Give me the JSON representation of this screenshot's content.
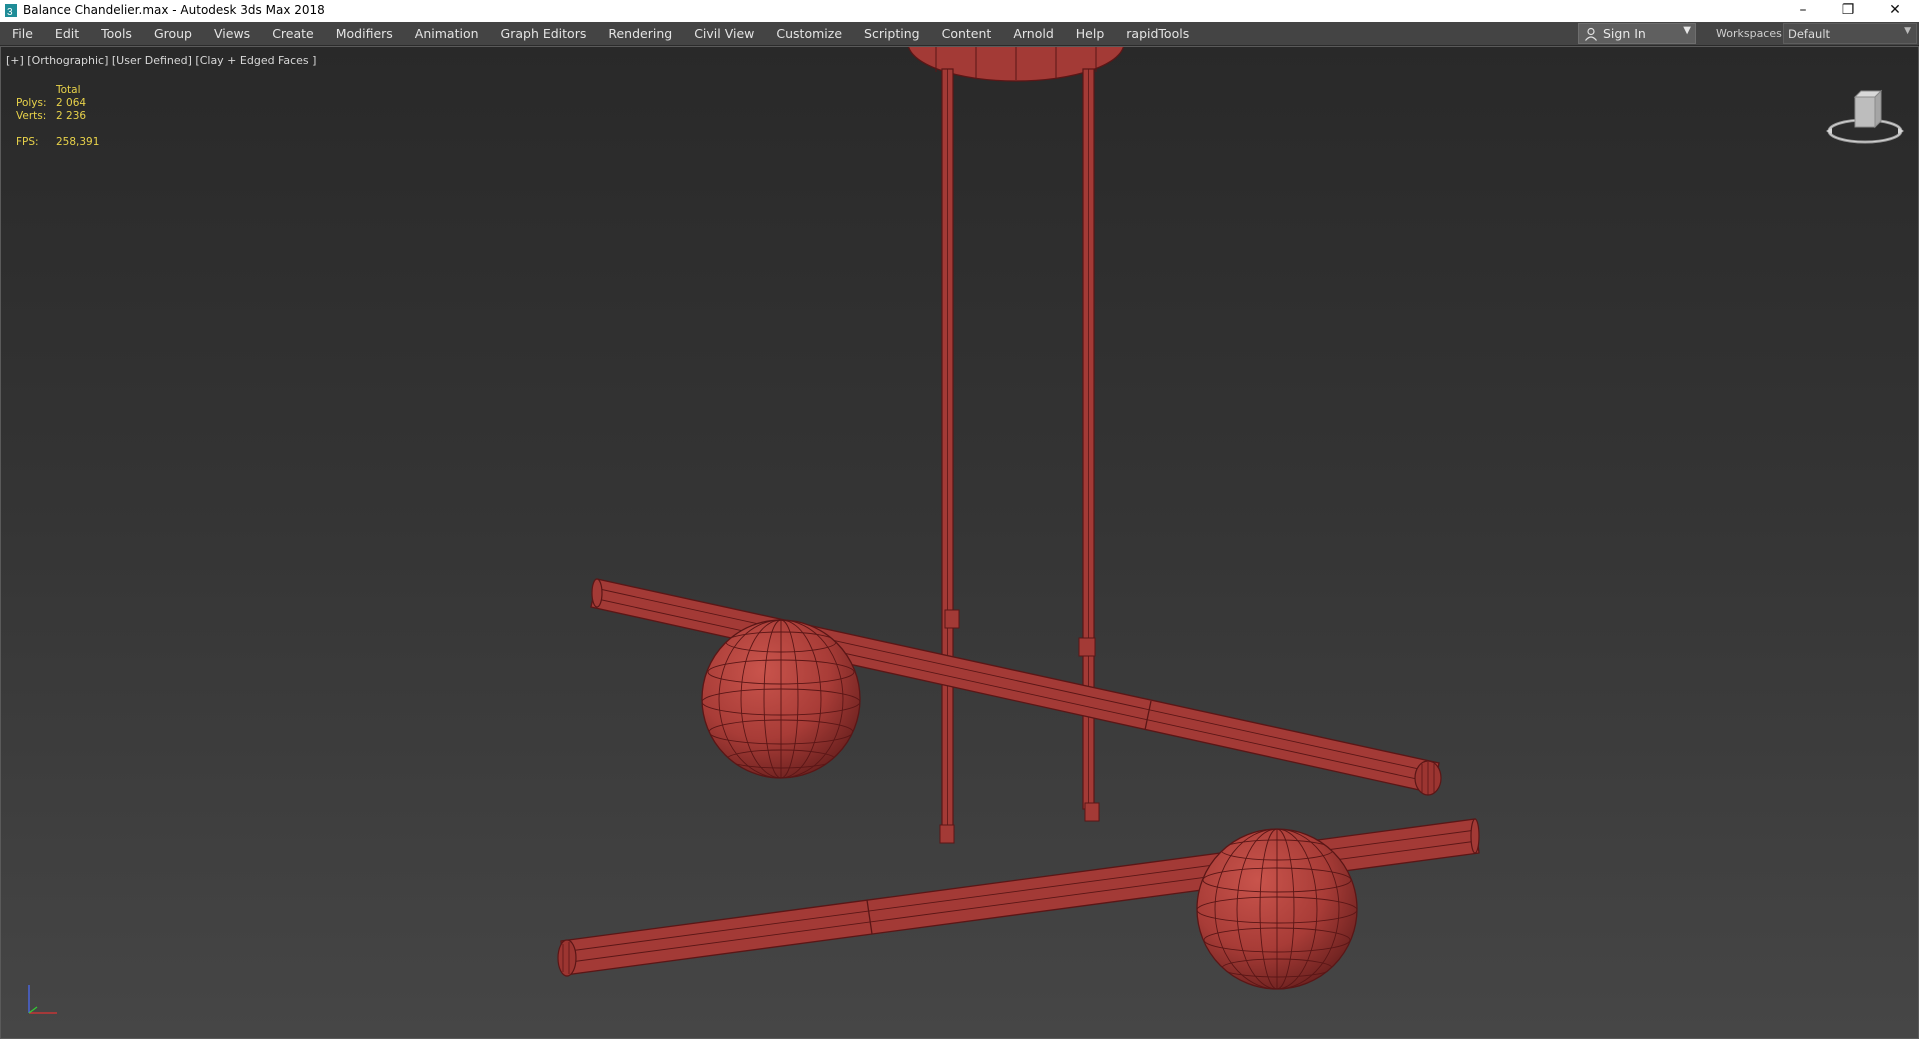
{
  "window": {
    "title": "Balance Chandelier.max - Autodesk 3ds Max 2018",
    "controls": [
      "minimize",
      "restore",
      "close"
    ],
    "control_glyphs": [
      "–",
      "❐",
      "✕"
    ]
  },
  "menubar": {
    "items": [
      "File",
      "Edit",
      "Tools",
      "Group",
      "Views",
      "Create",
      "Modifiers",
      "Animation",
      "Graph Editors",
      "Rendering",
      "Civil View",
      "Customize",
      "Scripting",
      "Content",
      "Arnold",
      "Help",
      "rapidTools"
    ],
    "sign_in": "Sign In",
    "workspaces_label": "Workspaces:",
    "workspace_value": "Default"
  },
  "viewport": {
    "label": "[+] [Orthographic] [User Defined] [Clay + Edged Faces ]",
    "stats": {
      "total_label": "Total",
      "polys_label": "Polys:",
      "polys_value": "2 064",
      "verts_label": "Verts:",
      "verts_value": "2 236",
      "fps_label": "FPS:",
      "fps_value": "258,391"
    }
  },
  "colors": {
    "model": "#a33a36",
    "model_dark": "#5a1616",
    "stats_text": "#e8d24a",
    "menubar_bg": "#444444"
  },
  "icons": {
    "app": "3ds-max-app-icon",
    "user": "user-icon",
    "viewcube": "viewcube-icon",
    "axis": "axis-tripod-icon"
  }
}
